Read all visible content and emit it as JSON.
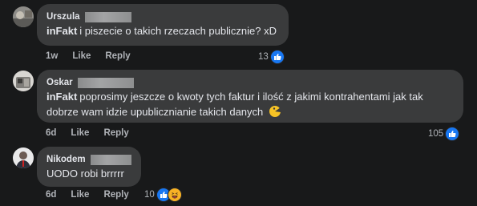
{
  "comments": [
    {
      "author": "Urszula",
      "mention": "inFakt",
      "text": "i piszecie o takich rzeczach publicznie? xD",
      "actions": {
        "time": "1w",
        "like": "Like",
        "reply": "Reply"
      },
      "reaction_count": "13",
      "reaction_icons": [
        "like-icon"
      ]
    },
    {
      "author": "Oskar",
      "mention": "inFakt",
      "text_line1": "poprosimy jeszcze o kwoty tych faktur i ilość z jakimi kontrahentami jak tak",
      "text_line2": "dobrze wam idzie upublicznianie takich danych",
      "emoji": "pacman-emoji",
      "actions": {
        "time": "6d",
        "like": "Like",
        "reply": "Reply"
      },
      "reaction_count": "105",
      "reaction_icons": [
        "like-icon"
      ]
    },
    {
      "author": "Nikodem",
      "text": "UODO robi brrrrr",
      "actions": {
        "time": "6d",
        "like": "Like",
        "reply": "Reply"
      },
      "reaction_count": "10",
      "reaction_icons": [
        "like-icon",
        "haha-icon"
      ]
    }
  ],
  "colors": {
    "background": "#18191a",
    "bubble": "#3a3b3c",
    "meta_text": "#b0b3b8",
    "like_blue": "#1877f2",
    "haha_yellow": "#f7b125"
  }
}
